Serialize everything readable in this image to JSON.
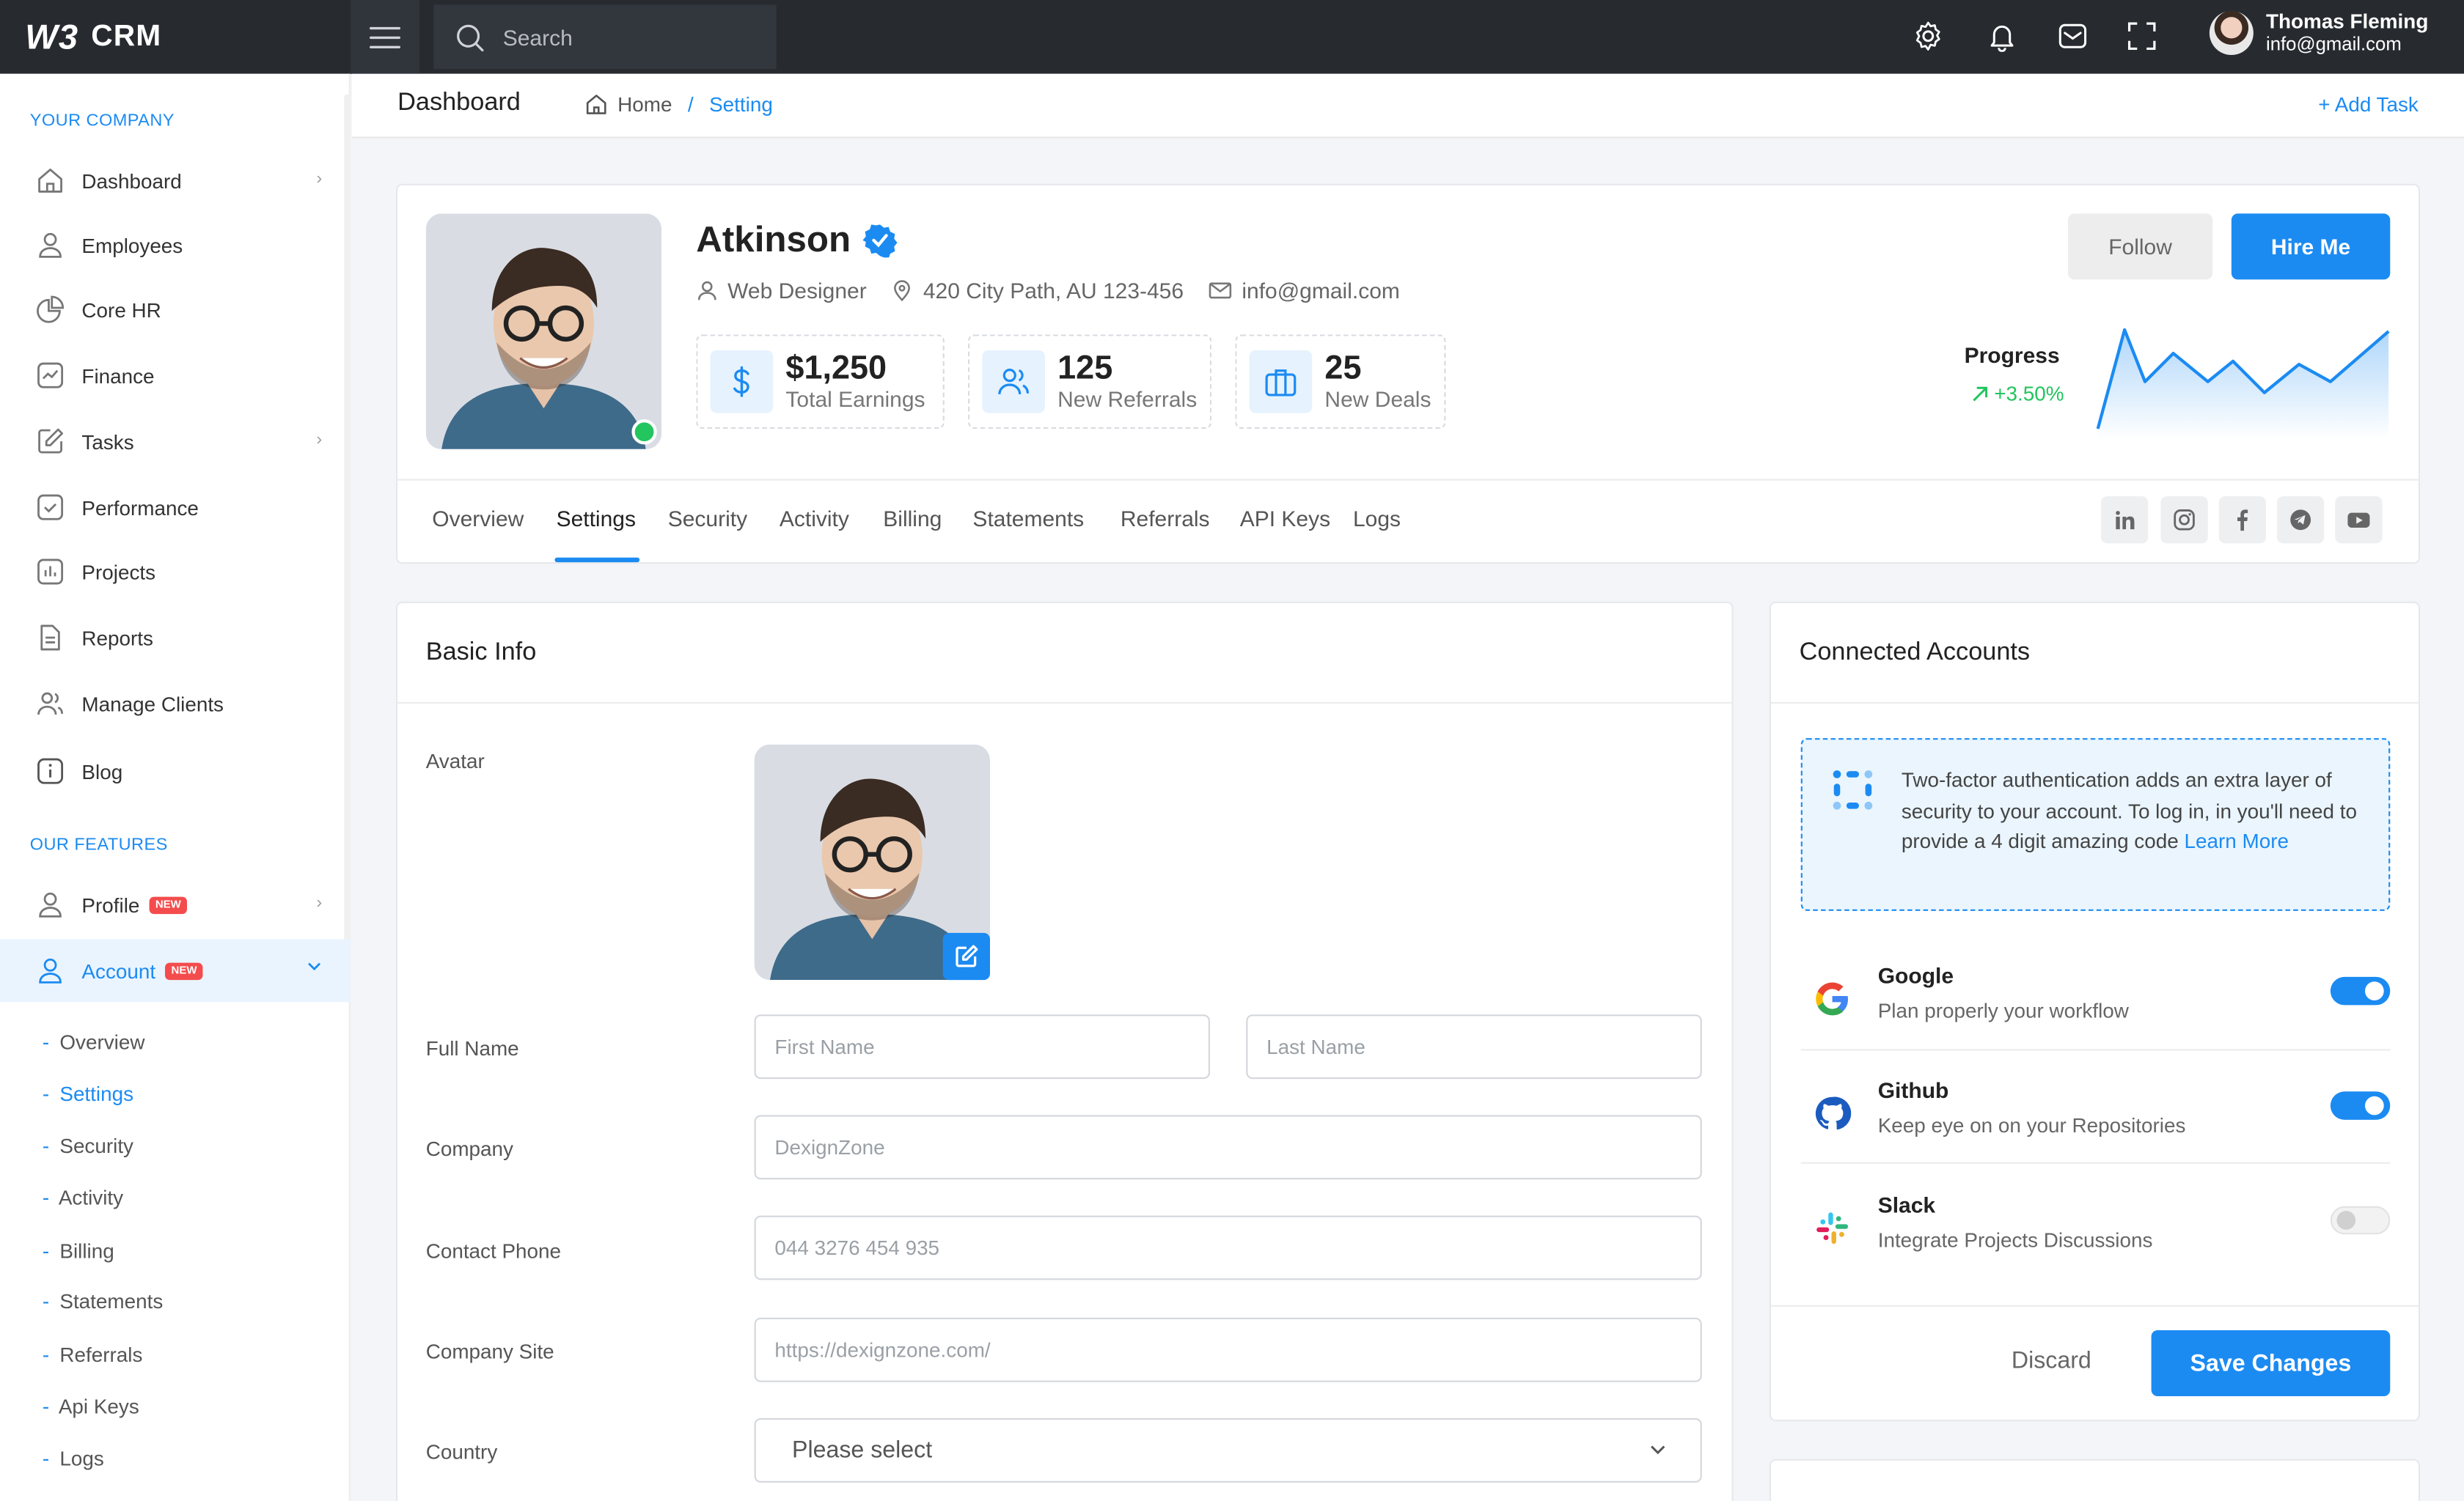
{
  "app": {
    "logo_mark": "W3",
    "name": "CRM"
  },
  "search": {
    "placeholder": "Search"
  },
  "user": {
    "name": "Thomas Fleming",
    "email": "info@gmail.com"
  },
  "sidebar": {
    "section1": "YOUR COMPANY",
    "items": [
      {
        "label": "Dashboard",
        "icon": "home-icon"
      },
      {
        "label": "Employees",
        "icon": "user-icon"
      },
      {
        "label": "Core HR",
        "icon": "pie-chart-icon"
      },
      {
        "label": "Finance",
        "icon": "chart-icon"
      },
      {
        "label": "Tasks",
        "icon": "edit-icon"
      },
      {
        "label": "Performance",
        "icon": "check-square-icon"
      },
      {
        "label": "Projects",
        "icon": "bar-chart-icon"
      },
      {
        "label": "Reports",
        "icon": "file-icon"
      },
      {
        "label": "Manage Clients",
        "icon": "users-icon"
      },
      {
        "label": "Blog",
        "icon": "info-icon"
      }
    ],
    "section2": "OUR FEATURES",
    "profile": {
      "label": "Profile",
      "badge": "NEW"
    },
    "account": {
      "label": "Account",
      "badge": "NEW"
    },
    "subitems": [
      "Overview",
      "Settings",
      "Security",
      "Activity",
      "Billing",
      "Statements",
      "Referrals",
      "Api Keys",
      "Logs"
    ]
  },
  "header": {
    "title": "Dashboard",
    "crumb_home": "Home",
    "crumb_current": "Setting",
    "add_task": "+ Add Task"
  },
  "profile": {
    "name": "Atkinson",
    "role": "Web Designer",
    "address": "420 City Path, AU 123-456",
    "email": "info@gmail.com",
    "stats": [
      {
        "value": "$1,250",
        "label": "Total Earnings",
        "icon": "dollar-icon"
      },
      {
        "value": "125",
        "label": "New Referrals",
        "icon": "users-icon"
      },
      {
        "value": "25",
        "label": "New Deals",
        "icon": "briefcase-icon"
      }
    ],
    "follow": "Follow",
    "hire": "Hire Me",
    "progress_label": "Progress",
    "progress_value": "+3.50%"
  },
  "tabs": [
    "Overview",
    "Settings",
    "Security",
    "Activity",
    "Billing",
    "Statements",
    "Referrals",
    "API Keys",
    "Logs"
  ],
  "social": [
    "linkedin-icon",
    "instagram-icon",
    "facebook-icon",
    "telegram-icon",
    "youtube-icon"
  ],
  "basic_info": {
    "title": "Basic Info",
    "avatar_label": "Avatar",
    "fullname_label": "Full Name",
    "first_placeholder": "First Name",
    "last_placeholder": "Last Name",
    "company_label": "Company",
    "company_placeholder": "DexignZone",
    "phone_label": "Contact Phone",
    "phone_placeholder": "044 3276 454 935",
    "site_label": "Company Site",
    "site_placeholder": "https://dexignzone.com/",
    "country_label": "Country",
    "country_value": "Please select"
  },
  "connected": {
    "title": "Connected Accounts",
    "notice": "Two-factor authentication adds an extra layer of security to your account. To log in, in you'll need to provide a 4 digit amazing code",
    "notice_link": "Learn More",
    "accounts": [
      {
        "name": "Google",
        "desc": "Plan properly your workflow",
        "enabled": true
      },
      {
        "name": "Github",
        "desc": "Keep eye on on your Repositories",
        "enabled": true
      },
      {
        "name": "Slack",
        "desc": "Integrate Projects Discussions",
        "enabled": false
      }
    ],
    "discard": "Discard",
    "save": "Save Changes"
  },
  "colors": {
    "accent": "#1b8bf2",
    "topbar": "#272b30",
    "success": "#22c55e",
    "danger": "#f44c4c"
  }
}
